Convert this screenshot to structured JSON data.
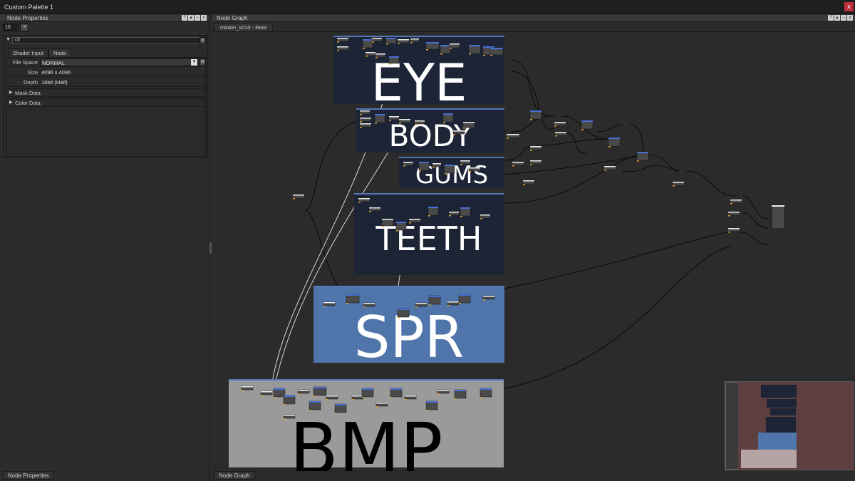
{
  "window": {
    "title": "Custom Palette 1",
    "close": "x"
  },
  "left_panel": {
    "title": "Node Properties",
    "header_buttons": [
      "?",
      "▲",
      "–",
      "x"
    ],
    "count_value": "10",
    "count_button": "⇥",
    "node_name": "clr",
    "node_clear": "x",
    "tabs": [
      "Shader Input",
      "Node"
    ],
    "props": {
      "file_space_label": "File Space",
      "file_space_value": "NORMAL",
      "file_space_reset": "R",
      "size_label": "Size",
      "size_value": "4096 x 4096",
      "depth_label": "Depth",
      "depth_value": "16bit (Half)"
    },
    "sections": [
      "Mask Data",
      "Color Data"
    ],
    "bottom_tab": "Node Properties"
  },
  "right_panel": {
    "title": "Node Graph",
    "header_buttons": [
      "?",
      "▲",
      "–",
      "x"
    ],
    "graph_tab": "minion_v010 - Root",
    "bottom_tab": "Node Graph"
  },
  "graph": {
    "backdrops": [
      {
        "label": "EYE",
        "color": "#1c2436",
        "text_color": "#ffffff"
      },
      {
        "label": "BODY",
        "color": "#1c2436",
        "text_color": "#ffffff"
      },
      {
        "label": "GUMS",
        "color": "#1c2436",
        "text_color": "#ffffff"
      },
      {
        "label": "TEETH",
        "color": "#1c2436",
        "text_color": "#ffffff"
      },
      {
        "label": "SPR",
        "color": "#4f75aa",
        "text_color": "#ffffff"
      },
      {
        "label": "BMP",
        "color": "#9a9a9a",
        "text_color": "#000000"
      }
    ],
    "colors": {
      "node_body": "#4a4a4a",
      "node_top": "#4a6fd6",
      "wire": "#0a0a0a",
      "wire_highlight": "#d8d8d8",
      "navigator_bg": "#5e3f3f"
    }
  }
}
